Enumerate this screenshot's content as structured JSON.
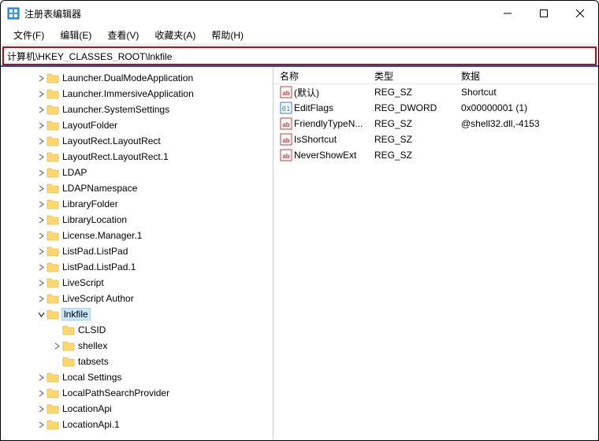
{
  "window": {
    "title": "注册表编辑器"
  },
  "menu": {
    "file": "文件(F)",
    "edit": "编辑(E)",
    "view": "查看(V)",
    "favorites": "收藏夹(A)",
    "help": "帮助(H)"
  },
  "address": "计算机\\HKEY_CLASSES_ROOT\\lnkfile",
  "tree": [
    {
      "label": "Launcher.DualModeApplication",
      "indent": 44,
      "chev": "right"
    },
    {
      "label": "Launcher.ImmersiveApplication",
      "indent": 44,
      "chev": "right"
    },
    {
      "label": "Launcher.SystemSettings",
      "indent": 44,
      "chev": "right"
    },
    {
      "label": "LayoutFolder",
      "indent": 44,
      "chev": "right"
    },
    {
      "label": "LayoutRect.LayoutRect",
      "indent": 44,
      "chev": "right"
    },
    {
      "label": "LayoutRect.LayoutRect.1",
      "indent": 44,
      "chev": "right"
    },
    {
      "label": "LDAP",
      "indent": 44,
      "chev": "right"
    },
    {
      "label": "LDAPNamespace",
      "indent": 44,
      "chev": "right"
    },
    {
      "label": "LibraryFolder",
      "indent": 44,
      "chev": "right"
    },
    {
      "label": "LibraryLocation",
      "indent": 44,
      "chev": "right"
    },
    {
      "label": "License.Manager.1",
      "indent": 44,
      "chev": "right"
    },
    {
      "label": "ListPad.ListPad",
      "indent": 44,
      "chev": "right"
    },
    {
      "label": "ListPad.ListPad.1",
      "indent": 44,
      "chev": "right"
    },
    {
      "label": "LiveScript",
      "indent": 44,
      "chev": "right"
    },
    {
      "label": "LiveScript Author",
      "indent": 44,
      "chev": "right"
    },
    {
      "label": "lnkfile",
      "indent": 44,
      "chev": "down",
      "selected": true
    },
    {
      "label": "CLSID",
      "indent": 64,
      "chev": "none"
    },
    {
      "label": "shellex",
      "indent": 64,
      "chev": "right"
    },
    {
      "label": "tabsets",
      "indent": 64,
      "chev": "none"
    },
    {
      "label": "Local Settings",
      "indent": 44,
      "chev": "right"
    },
    {
      "label": "LocalPathSearchProvider",
      "indent": 44,
      "chev": "right"
    },
    {
      "label": "LocationApi",
      "indent": 44,
      "chev": "right"
    },
    {
      "label": "LocationApi.1",
      "indent": 44,
      "chev": "right"
    }
  ],
  "columns": {
    "name": "名称",
    "type": "类型",
    "data": "数据"
  },
  "values": [
    {
      "icon": "str",
      "name": "(默认)",
      "type": "REG_SZ",
      "data": "Shortcut"
    },
    {
      "icon": "bin",
      "name": "EditFlags",
      "type": "REG_DWORD",
      "data": "0x00000001 (1)"
    },
    {
      "icon": "str",
      "name": "FriendlyTypeN...",
      "type": "REG_SZ",
      "data": "@shell32.dll,-4153"
    },
    {
      "icon": "str",
      "name": "IsShortcut",
      "type": "REG_SZ",
      "data": ""
    },
    {
      "icon": "str",
      "name": "NeverShowExt",
      "type": "REG_SZ",
      "data": ""
    }
  ]
}
